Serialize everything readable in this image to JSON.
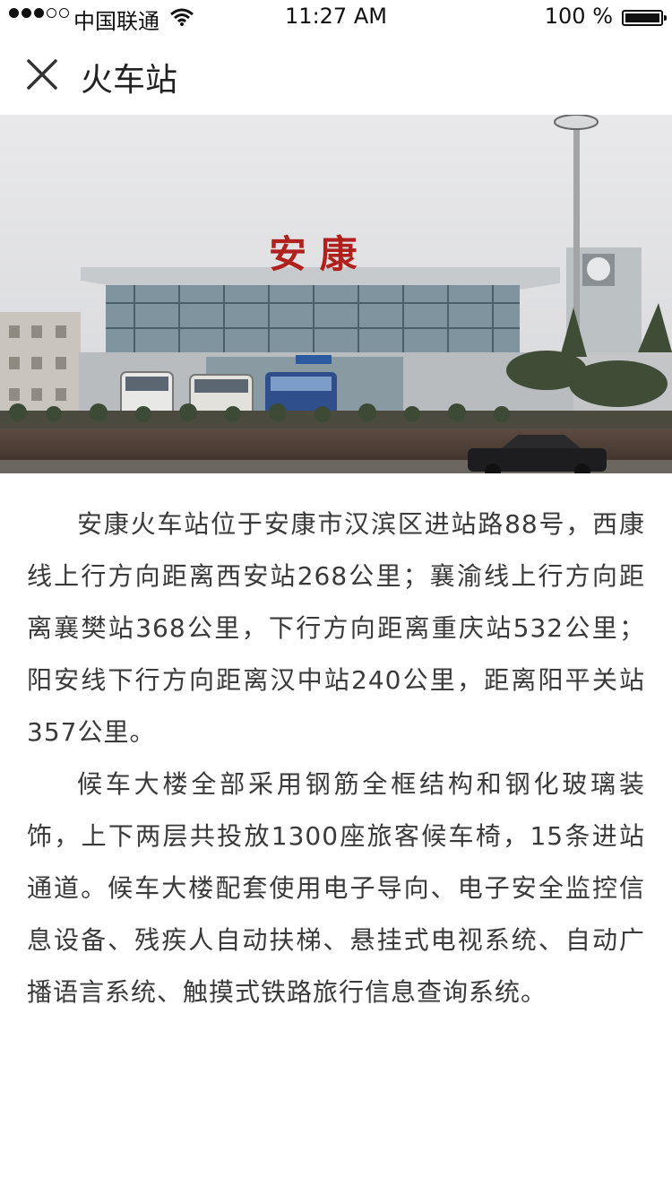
{
  "status_bar": {
    "carrier": "●●●○○ 中国联通",
    "carrier_name": "中国联通",
    "wifi_icon": "wifi-icon",
    "time": "11:27 AM",
    "battery_percent": "100 %",
    "battery_level": 1.0
  },
  "nav": {
    "close_icon": "close-icon",
    "title": "火车站"
  },
  "hero_image": {
    "sign_text": "安 康"
  },
  "article": {
    "paragraphs": [
      "安康火车站位于安康市汉滨区进站路88号，西康线上行方向距离西安站268公里；襄渝线上行方向距离襄樊站368公里，下行方向距离重庆站532公里；阳安线下行方向距离汉中站240公里，距离阳平关站357公里。",
      "候车大楼全部采用钢筋全框结构和钢化玻璃装饰，上下两层共投放1300座旅客候车椅，15条进站通道。候车大楼配套使用电子导向、电子安全监控信息设备、残疾人自动扶梯、悬挂式电视系统、自动广播语言系统、触摸式铁路旅行信息查询系统。"
    ]
  }
}
